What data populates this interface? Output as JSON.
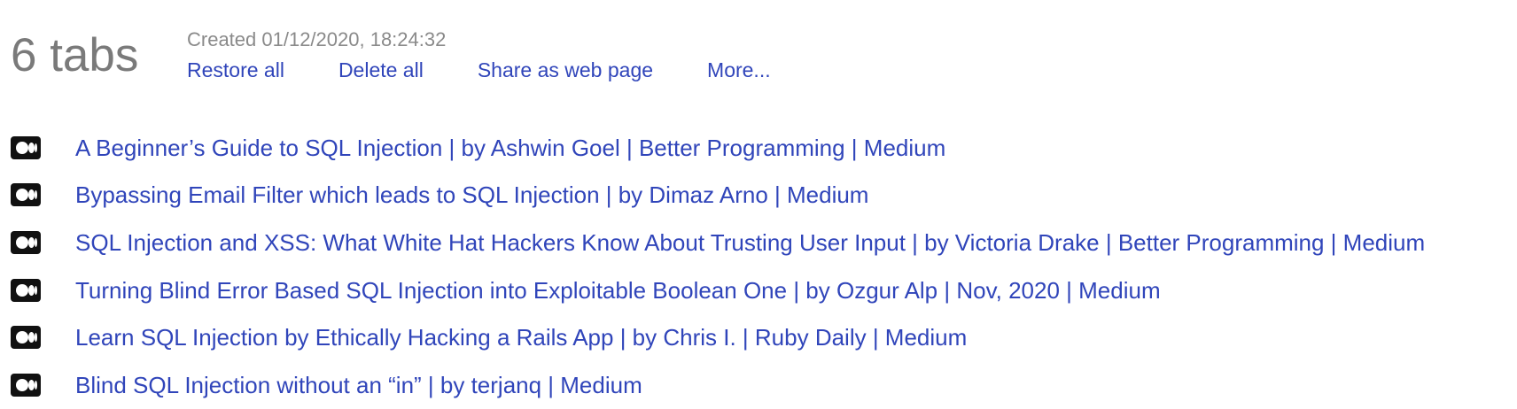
{
  "group": {
    "tab_count": "6 tabs",
    "created": "Created 01/12/2020, 18:24:32",
    "actions": {
      "restore_all": "Restore all",
      "delete_all": "Delete all",
      "share": "Share as web page",
      "more": "More..."
    },
    "tabs": [
      {
        "title": "A Beginner’s Guide to SQL Injection | by Ashwin Goel | Better Programming | Medium",
        "favicon": "medium-icon"
      },
      {
        "title": "Bypassing Email Filter which leads to SQL Injection | by Dimaz Arno | Medium",
        "favicon": "medium-icon"
      },
      {
        "title": "SQL Injection and XSS: What White Hat Hackers Know About Trusting User Input | by Victoria Drake | Better Programming | Medium",
        "favicon": "medium-icon"
      },
      {
        "title": "Turning Blind Error Based SQL Injection into Exploitable Boolean One | by Ozgur Alp | Nov, 2020 | Medium",
        "favicon": "medium-icon"
      },
      {
        "title": "Learn SQL Injection by Ethically Hacking a Rails App | by Chris I. | Ruby Daily | Medium",
        "favicon": "medium-icon"
      },
      {
        "title": "Blind SQL Injection without an “in” | by terjanq | Medium",
        "favicon": "medium-icon"
      }
    ]
  },
  "colors": {
    "link": "#3045ba",
    "count": "#7a7a7a",
    "meta": "#8a8a8a",
    "favicon_bg": "#111111"
  }
}
